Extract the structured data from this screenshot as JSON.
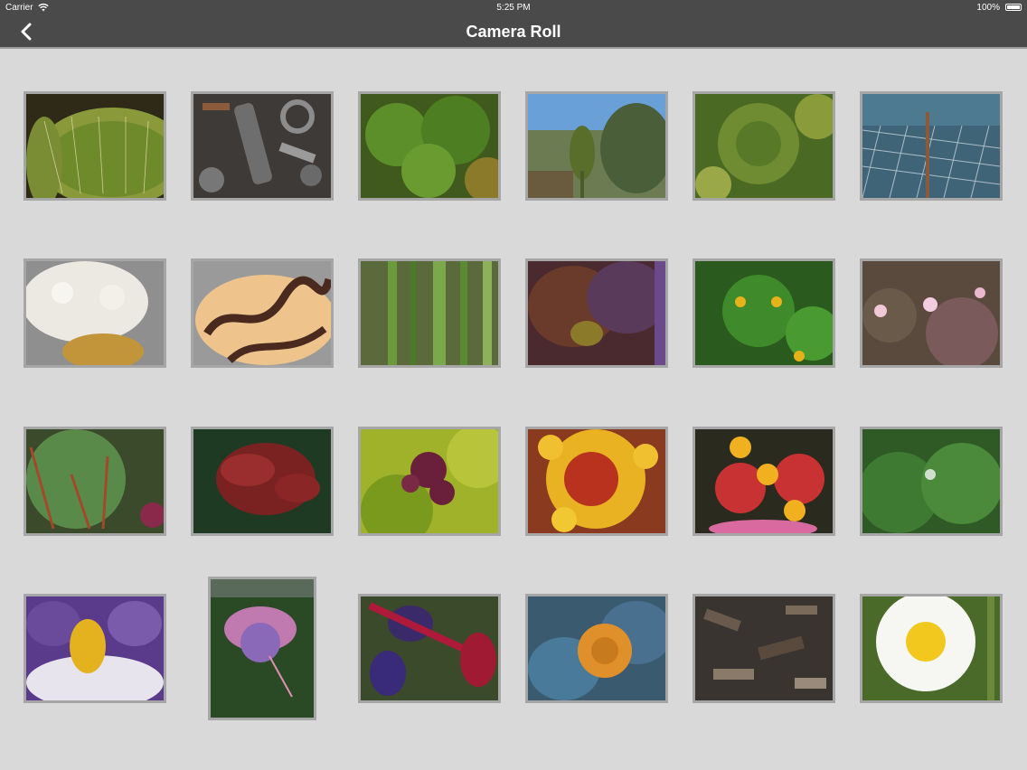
{
  "status_bar": {
    "carrier": "Carrier",
    "time": "5:25 PM",
    "battery": "100%"
  },
  "nav": {
    "title": "Camera Roll",
    "back_icon": "chevron-left-icon"
  },
  "colors": {
    "nav_background": "#4a4a4a",
    "page_background": "#d9d9d9",
    "thumbnail_border": "#a6a6a6"
  },
  "photos": [
    {
      "subject": "cactus"
    },
    {
      "subject": "screws-and-bolts"
    },
    {
      "subject": "green-leaves"
    },
    {
      "subject": "bud-with-sky"
    },
    {
      "subject": "succulent-leaves"
    },
    {
      "subject": "wire-fence-water"
    },
    {
      "subject": "coconut-dessert"
    },
    {
      "subject": "chocolate-drizzle-dessert"
    },
    {
      "subject": "grass-stems"
    },
    {
      "subject": "purple-flower-closeup"
    },
    {
      "subject": "small-yellow-flowers"
    },
    {
      "subject": "pink-small-flowers"
    },
    {
      "subject": "green-leaf-red-stems"
    },
    {
      "subject": "red-leaves"
    },
    {
      "subject": "purple-berries"
    },
    {
      "subject": "yellow-lantana"
    },
    {
      "subject": "red-yellow-lantana"
    },
    {
      "subject": "green-leaves-droplet"
    },
    {
      "subject": "iris-flower"
    },
    {
      "subject": "fuchsia-flower"
    },
    {
      "subject": "red-purple-fuchsia"
    },
    {
      "subject": "blue-poppy"
    },
    {
      "subject": "bark-mulch"
    },
    {
      "subject": "daisy"
    }
  ]
}
